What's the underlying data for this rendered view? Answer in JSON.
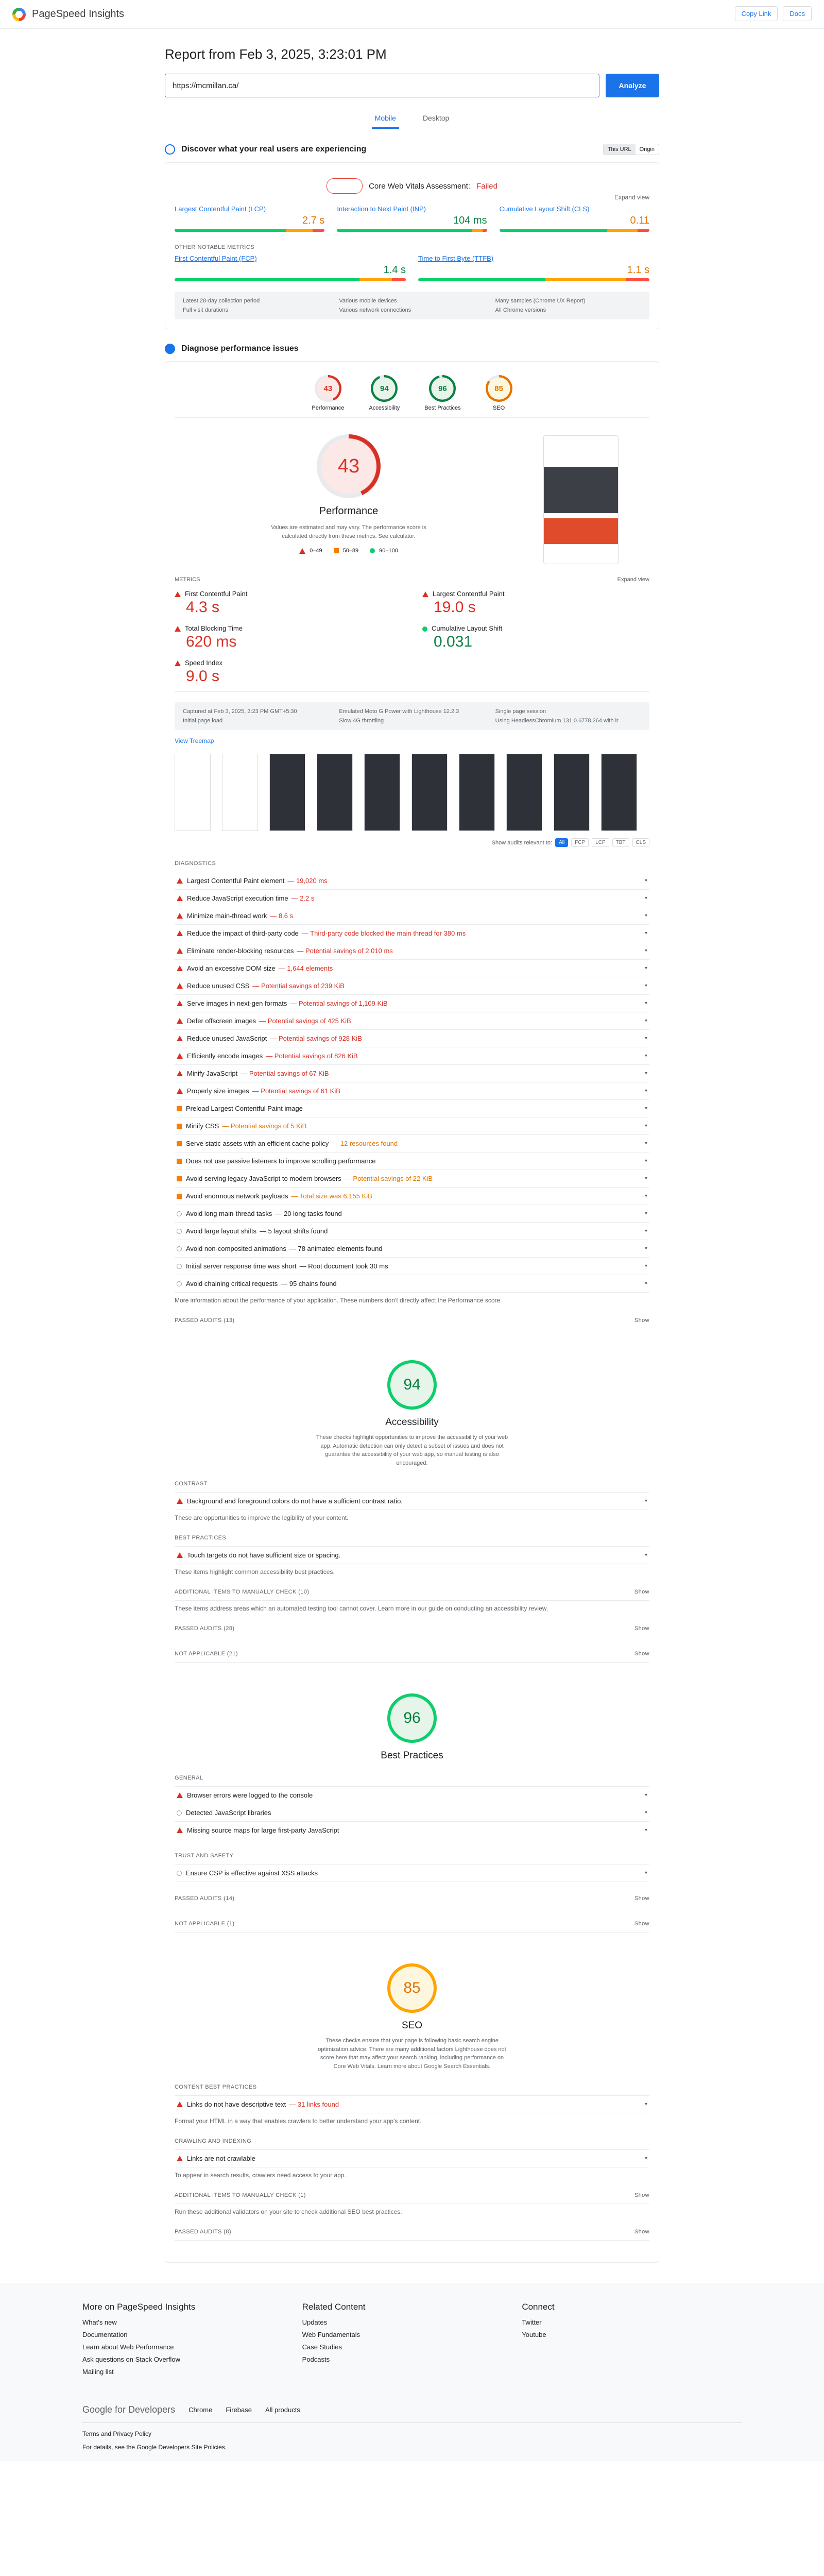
{
  "header": {
    "brand": "PageSpeed Insights",
    "copy": "Copy Link",
    "docs": "Docs"
  },
  "report": {
    "title": "Report from Feb 3, 2025, 3:23:01 PM",
    "url": "https://mcmillan.ca/",
    "analyze": "Analyze",
    "tabs": [
      {
        "label": "Mobile",
        "active": true
      },
      {
        "label": "Desktop",
        "active": false
      }
    ]
  },
  "field": {
    "heading": "Discover what your real users are experiencing",
    "toggle": [
      "This URL",
      "Origin"
    ],
    "cwv_title": "Core Web Vitals Assessment:",
    "cwv_status": "Failed",
    "expand": "Expand view",
    "core": [
      {
        "label": "Largest Contentful Paint (LCP)",
        "value": "2.7 s",
        "status": "warn",
        "dist": [
          74,
          18,
          8
        ]
      },
      {
        "label": "Interaction to Next Paint (INP)",
        "value": "104 ms",
        "status": "ok",
        "dist": [
          90,
          7,
          3
        ]
      },
      {
        "label": "Cumulative Layout Shift (CLS)",
        "value": "0.11",
        "status": "warn",
        "dist": [
          72,
          20,
          8
        ]
      }
    ],
    "other_head": "OTHER NOTABLE METRICS",
    "other": [
      {
        "label": "First Contentful Paint (FCP)",
        "value": "1.4 s",
        "status": "ok",
        "dist": [
          80,
          14,
          6
        ]
      },
      {
        "label": "Time to First Byte (TTFB)",
        "value": "1.1 s",
        "status": "warn",
        "dist": [
          55,
          35,
          10
        ]
      }
    ],
    "info": [
      "Latest 28-day collection period",
      "Various mobile devices",
      "Many samples (Chrome UX Report)",
      "Full visit durations",
      "Various network connections",
      "All Chrome versions"
    ]
  },
  "lab": {
    "heading": "Diagnose performance issues",
    "gauges": [
      {
        "label": "Performance",
        "score": "43",
        "color": "#d93025",
        "bg": "#fce8e6",
        "frac": 0.43
      },
      {
        "label": "Accessibility",
        "score": "94",
        "color": "#0b8043",
        "bg": "#e6f4ea",
        "frac": 0.94
      },
      {
        "label": "Best Practices",
        "score": "96",
        "color": "#0b8043",
        "bg": "#e6f4ea",
        "frac": 0.96
      },
      {
        "label": "SEO",
        "score": "85",
        "color": "#e37400",
        "bg": "#fef7e0",
        "frac": 0.85
      }
    ],
    "perf_title": "Performance",
    "perf_desc": "Values are estimated and may vary. The performance score is calculated directly from these metrics. See calculator.",
    "legend": [
      "0–49",
      "50–89",
      "90–100"
    ],
    "metrics_head": "METRICS",
    "expand": "Expand view",
    "metrics": [
      {
        "label": "First Contentful Paint",
        "value": "4.3 s",
        "status": "bad"
      },
      {
        "label": "Largest Contentful Paint",
        "value": "19.0 s",
        "status": "bad"
      },
      {
        "label": "Total Blocking Time",
        "value": "620 ms",
        "status": "bad"
      },
      {
        "label": "Cumulative Layout Shift",
        "value": "0.031",
        "status": "ok"
      },
      {
        "label": "Speed Index",
        "value": "9.0 s",
        "status": "bad"
      }
    ],
    "info": [
      "Captured at Feb 3, 2025, 3:23 PM GMT+5:30",
      "Emulated Moto G Power with Lighthouse 12.2.3",
      "Single page session",
      "Initial page load",
      "Slow 4G throttling",
      "Using HeadlessChromium 131.0.6778.264 with lr"
    ],
    "treemap": "View Treemap",
    "filter_label": "Show audits relevant to:",
    "filters": [
      "All",
      "FCP",
      "LCP",
      "TBT",
      "CLS"
    ],
    "diag_head": "DIAGNOSTICS",
    "audits": [
      {
        "t": "Largest Contentful Paint element",
        "d": "— 19,020 ms",
        "s": "bad"
      },
      {
        "t": "Reduce JavaScript execution time",
        "d": "— 2.2 s",
        "s": "bad"
      },
      {
        "t": "Minimize main-thread work",
        "d": "— 8.6 s",
        "s": "bad"
      },
      {
        "t": "Reduce the impact of third-party code",
        "d": "— Third-party code blocked the main thread for 380 ms",
        "s": "bad"
      },
      {
        "t": "Eliminate render-blocking resources",
        "d": "— Potential savings of 2,010 ms",
        "s": "bad"
      },
      {
        "t": "Avoid an excessive DOM size",
        "d": "— 1,644 elements",
        "s": "bad"
      },
      {
        "t": "Reduce unused CSS",
        "d": "— Potential savings of 239 KiB",
        "s": "bad"
      },
      {
        "t": "Serve images in next-gen formats",
        "d": "— Potential savings of 1,109 KiB",
        "s": "bad"
      },
      {
        "t": "Defer offscreen images",
        "d": "— Potential savings of 425 KiB",
        "s": "bad"
      },
      {
        "t": "Reduce unused JavaScript",
        "d": "— Potential savings of 928 KiB",
        "s": "bad"
      },
      {
        "t": "Efficiently encode images",
        "d": "— Potential savings of 826 KiB",
        "s": "bad"
      },
      {
        "t": "Minify JavaScript",
        "d": "— Potential savings of 67 KiB",
        "s": "bad"
      },
      {
        "t": "Properly size images",
        "d": "— Potential savings of 61 KiB",
        "s": "bad"
      },
      {
        "t": "Preload Largest Contentful Paint image",
        "d": "",
        "s": "warn"
      },
      {
        "t": "Minify CSS",
        "d": "— Potential savings of 5 KiB",
        "s": "warn"
      },
      {
        "t": "Serve static assets with an efficient cache policy",
        "d": "— 12 resources found",
        "s": "warn"
      },
      {
        "t": "Does not use passive listeners to improve scrolling performance",
        "d": "",
        "s": "warn"
      },
      {
        "t": "Avoid serving legacy JavaScript to modern browsers",
        "d": "— Potential savings of 22 KiB",
        "s": "warn"
      },
      {
        "t": "Avoid enormous network payloads",
        "d": "— Total size was 6,155 KiB",
        "s": "warn"
      },
      {
        "t": "Avoid long main-thread tasks",
        "d": "— 20 long tasks found",
        "s": "info"
      },
      {
        "t": "Avoid large layout shifts",
        "d": "— 5 layout shifts found",
        "s": "info"
      },
      {
        "t": "Avoid non-composited animations",
        "d": "— 78 animated elements found",
        "s": "info"
      },
      {
        "t": "Initial server response time was short",
        "d": "— Root document took 30 ms",
        "s": "info"
      },
      {
        "t": "Avoid chaining critical requests",
        "d": "— 95 chains found",
        "s": "info"
      }
    ],
    "diag_note": "More information about the performance of your application. These numbers don't directly affect the Performance score.",
    "passed": "PASSED AUDITS (13)",
    "show": "Show"
  },
  "a11y": {
    "score": "94",
    "title": "Accessibility",
    "desc": "These checks highlight opportunities to improve the accessibility of your web app. Automatic detection can only detect a subset of issues and does not guarantee the accessibility of your web app, so manual testing is also encouraged.",
    "groups": [
      {
        "head": "CONTRAST",
        "items": [
          "Background and foreground colors do not have a sufficient contrast ratio."
        ],
        "note": "These are opportunities to improve the legibility of your content."
      },
      {
        "head": "BEST PRACTICES",
        "items": [
          "Touch targets do not have sufficient size or spacing."
        ],
        "note": "These items highlight common accessibility best practices."
      }
    ],
    "manual": "ADDITIONAL ITEMS TO MANUALLY CHECK (10)",
    "manual_note": "These items address areas which an automated testing tool cannot cover. Learn more in our guide on conducting an accessibility review.",
    "passed": "PASSED AUDITS (28)",
    "na": "NOT APPLICABLE (21)"
  },
  "bp": {
    "score": "96",
    "title": "Best Practices",
    "general": "GENERAL",
    "general_items": [
      {
        "t": "Browser errors were logged to the console",
        "s": "bad"
      },
      {
        "t": "Detected JavaScript libraries",
        "s": "info"
      },
      {
        "t": "Missing source maps for large first-party JavaScript",
        "s": "bad"
      }
    ],
    "trust": "TRUST AND SAFETY",
    "trust_items": [
      {
        "t": "Ensure CSP is effective against XSS attacks",
        "s": "info"
      }
    ],
    "passed": "PASSED AUDITS (14)",
    "na": "NOT APPLICABLE (1)"
  },
  "seo": {
    "score": "85",
    "title": "SEO",
    "desc": "These checks ensure that your page is following basic search engine optimization advice. There are many additional factors Lighthouse does not score here that may affect your search ranking, including performance on Core Web Vitals. Learn more about Google Search Essentials.",
    "content": "CONTENT BEST PRACTICES",
    "content_item": "Links do not have descriptive text",
    "content_d": "— 31 links found",
    "content_note": "Format your HTML in a way that enables crawlers to better understand your app's content.",
    "crawl": "CRAWLING AND INDEXING",
    "crawl_item": "Links are not crawlable",
    "crawl_note": "To appear in search results, crawlers need access to your app.",
    "manual": "ADDITIONAL ITEMS TO MANUALLY CHECK (1)",
    "manual_note": "Run these additional validators on your site to check additional SEO best practices.",
    "passed": "PASSED AUDITS (8)"
  },
  "footer": {
    "cols": [
      {
        "head": "More on PageSpeed Insights",
        "links": [
          "What's new",
          "Documentation",
          "Learn about Web Performance",
          "Ask questions on Stack Overflow",
          "Mailing list"
        ]
      },
      {
        "head": "Related Content",
        "links": [
          "Updates",
          "Web Fundamentals",
          "Case Studies",
          "Podcasts"
        ]
      },
      {
        "head": "Connect",
        "links": [
          "Twitter",
          "Youtube"
        ]
      }
    ],
    "gfd": "Google for Developers",
    "bar_links": [
      "Chrome",
      "Firebase",
      "All products"
    ],
    "terms": "Terms and Privacy Policy",
    "details": "For details, see the Google Developers Site Policies."
  }
}
